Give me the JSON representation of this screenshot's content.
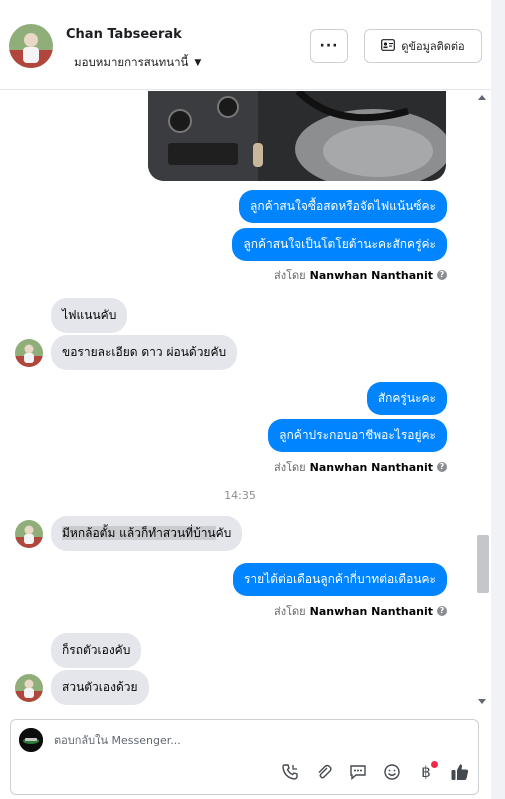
{
  "header": {
    "contact_name": "Chan Tabseerak",
    "assign_label": "มอบหมายการสนทนานี้",
    "more_label": "···",
    "contact_info_label": "ดูข้อมูลติดต่อ"
  },
  "messages": {
    "out1": "ลูกค้าสนใจซื้อสดหรือจัดไฟแน้นซ์คะ",
    "out2": "ลูกค้าสนใจเป็นโตโยต้านะคะสักครู่ค่ะ",
    "sent_prefix": "ส่งโดย",
    "agent": "Nanwhan Nanthanit",
    "info": "?",
    "in1": "ไฟแนนคับ",
    "in2": "ขอรายละเอียด ดาว ผ่อนด้วยคับ",
    "out3": "สักครู่นะคะ",
    "out4": "ลูกค้าประกอบอาชีพอะไรอยู่คะ",
    "time": "14:35",
    "in3_hl": "มีหกล้อตั้ม  แล้วก็ทำสวนที่บ้าน",
    "in3_rest": "คับ",
    "out5": "รายได้ต่อเดือนลูกค้ากี่บาทต่อเดือนคะ",
    "in4": "ก็รถตัวเองคับ",
    "in5": "สวนตัวเองด้วย"
  },
  "reply": {
    "placeholder": "ตอบกลับใน Messenger..."
  },
  "icons": [
    "call-icon",
    "attach-icon",
    "saved-reply-icon",
    "emoji-icon",
    "payment-icon",
    "thumbs-up-icon"
  ],
  "colors": {
    "outgoing": "#0084ff",
    "incoming": "#e4e6eb",
    "notify": "#f02849"
  }
}
